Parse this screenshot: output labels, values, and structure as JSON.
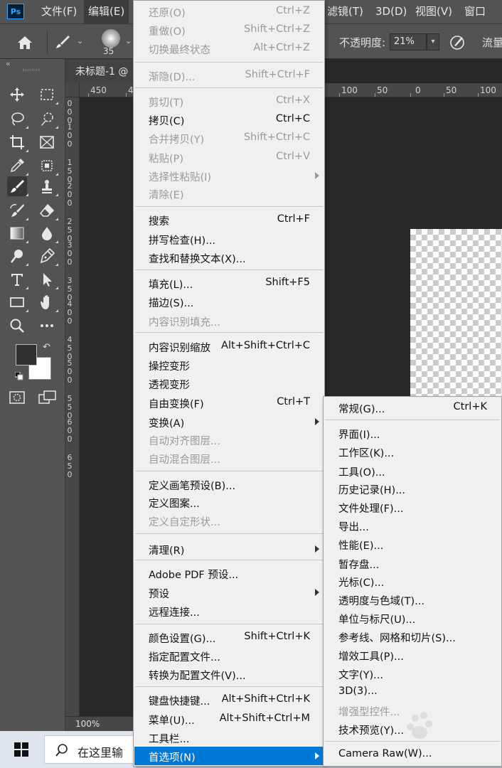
{
  "app": {
    "logo": "Ps"
  },
  "menubar": {
    "items": [
      "文件(F)",
      "编辑(E)",
      "滤镜(T)",
      "3D(D)",
      "视图(V)",
      "窗口"
    ]
  },
  "options_bar": {
    "brush_size": "35",
    "opacity_label": "不透明度:",
    "opacity_value": "21%",
    "flow_label": "流量"
  },
  "document": {
    "tab_title": "未标题-1 @",
    "zoom": "100%",
    "ruler_h_labels": [
      "450",
      "4",
      "100",
      "50",
      "0",
      "50",
      "100"
    ],
    "ruler_v_labels": [
      "0",
      "0",
      "0",
      "1",
      "0",
      "0",
      "1",
      "5",
      "0",
      "2",
      "0",
      "0",
      "2",
      "5",
      "0",
      "3",
      "0",
      "0",
      "3",
      "5",
      "0",
      "4",
      "0",
      "0",
      "4",
      "5",
      "0",
      "5",
      "0",
      "0",
      "5",
      "5",
      "0",
      "6",
      "0",
      "0",
      "6",
      "5",
      "0"
    ]
  },
  "taskbar": {
    "search_placeholder": "在这里输"
  },
  "edit_menu": {
    "items": [
      {
        "label": "还原(O)",
        "shortcut": "Ctrl+Z",
        "disabled": true
      },
      {
        "label": "重做(O)",
        "shortcut": "Shift+Ctrl+Z",
        "disabled": true
      },
      {
        "label": "切换最终状态",
        "shortcut": "Alt+Ctrl+Z",
        "disabled": true
      },
      {
        "label": "渐隐(D)...",
        "shortcut": "Shift+Ctrl+F",
        "disabled": true
      },
      {
        "label": "剪切(T)",
        "shortcut": "Ctrl+X",
        "disabled": true
      },
      {
        "label": "拷贝(C)",
        "shortcut": "Ctrl+C",
        "disabled": false
      },
      {
        "label": "合并拷贝(Y)",
        "shortcut": "Shift+Ctrl+C",
        "disabled": true
      },
      {
        "label": "粘贴(P)",
        "shortcut": "Ctrl+V",
        "disabled": true
      },
      {
        "label": "选择性粘贴(I)",
        "shortcut": "",
        "disabled": true
      },
      {
        "label": "清除(E)",
        "shortcut": "",
        "disabled": true
      },
      {
        "label": "搜索",
        "shortcut": "Ctrl+F",
        "disabled": false
      },
      {
        "label": "拼写检查(H)...",
        "shortcut": "",
        "disabled": false
      },
      {
        "label": "查找和替换文本(X)...",
        "shortcut": "",
        "disabled": false
      },
      {
        "label": "填充(L)...",
        "shortcut": "Shift+F5",
        "disabled": false
      },
      {
        "label": "描边(S)...",
        "shortcut": "",
        "disabled": false
      },
      {
        "label": "内容识别填充...",
        "shortcut": "",
        "disabled": true
      },
      {
        "label": "内容识别缩放",
        "shortcut": "Alt+Shift+Ctrl+C",
        "disabled": false
      },
      {
        "label": "操控变形",
        "shortcut": "",
        "disabled": false
      },
      {
        "label": "透视变形",
        "shortcut": "",
        "disabled": false
      },
      {
        "label": "自由变换(F)",
        "shortcut": "Ctrl+T",
        "disabled": false
      },
      {
        "label": "变换(A)",
        "shortcut": "",
        "disabled": false
      },
      {
        "label": "自动对齐图层...",
        "shortcut": "",
        "disabled": true
      },
      {
        "label": "自动混合图层...",
        "shortcut": "",
        "disabled": true
      },
      {
        "label": "定义画笔预设(B)...",
        "shortcut": "",
        "disabled": false
      },
      {
        "label": "定义图案...",
        "shortcut": "",
        "disabled": false
      },
      {
        "label": "定义自定形状...",
        "shortcut": "",
        "disabled": true
      },
      {
        "label": "清理(R)",
        "shortcut": "",
        "disabled": false
      },
      {
        "label": "Adobe PDF 预设...",
        "shortcut": "",
        "disabled": false
      },
      {
        "label": "预设",
        "shortcut": "",
        "disabled": false
      },
      {
        "label": "远程连接...",
        "shortcut": "",
        "disabled": false
      },
      {
        "label": "颜色设置(G)...",
        "shortcut": "Shift+Ctrl+K",
        "disabled": false
      },
      {
        "label": "指定配置文件...",
        "shortcut": "",
        "disabled": false
      },
      {
        "label": "转换为配置文件(V)...",
        "shortcut": "",
        "disabled": false
      },
      {
        "label": "键盘快捷键...",
        "shortcut": "Alt+Shift+Ctrl+K",
        "disabled": false
      },
      {
        "label": "菜单(U)...",
        "shortcut": "Alt+Shift+Ctrl+M",
        "disabled": false
      },
      {
        "label": "工具栏...",
        "shortcut": "",
        "disabled": false
      },
      {
        "label": "首选项(N)",
        "shortcut": "",
        "disabled": false,
        "highlighted": true
      }
    ]
  },
  "preferences_menu": {
    "items": [
      {
        "label": "常规(G)...",
        "shortcut": "Ctrl+K",
        "disabled": false
      },
      {
        "label": "界面(I)...",
        "shortcut": "",
        "disabled": false
      },
      {
        "label": "工作区(K)...",
        "shortcut": "",
        "disabled": false
      },
      {
        "label": "工具(O)...",
        "shortcut": "",
        "disabled": false
      },
      {
        "label": "历史记录(H)...",
        "shortcut": "",
        "disabled": false
      },
      {
        "label": "文件处理(F)...",
        "shortcut": "",
        "disabled": false
      },
      {
        "label": "导出...",
        "shortcut": "",
        "disabled": false
      },
      {
        "label": "性能(E)...",
        "shortcut": "",
        "disabled": false
      },
      {
        "label": "暂存盘...",
        "shortcut": "",
        "disabled": false
      },
      {
        "label": "光标(C)...",
        "shortcut": "",
        "disabled": false
      },
      {
        "label": "透明度与色域(T)...",
        "shortcut": "",
        "disabled": false
      },
      {
        "label": "单位与标尺(U)...",
        "shortcut": "",
        "disabled": false
      },
      {
        "label": "参考线、网格和切片(S)...",
        "shortcut": "",
        "disabled": false
      },
      {
        "label": "增效工具(P)...",
        "shortcut": "",
        "disabled": false
      },
      {
        "label": "文字(Y)...",
        "shortcut": "",
        "disabled": false
      },
      {
        "label": "3D(3)...",
        "shortcut": "",
        "disabled": false
      },
      {
        "label": "增强型控件...",
        "shortcut": "",
        "disabled": true
      },
      {
        "label": "技术预览(Y)...",
        "shortcut": "",
        "disabled": false
      },
      {
        "label": "Camera Raw(W)...",
        "shortcut": "",
        "disabled": false
      }
    ]
  },
  "colors": {
    "menu_bg": "#f0f0f0",
    "highlight": "#0078d7",
    "panel": "#535353",
    "canvas_bg": "#282828",
    "disabled_text": "#9a9a9a"
  }
}
